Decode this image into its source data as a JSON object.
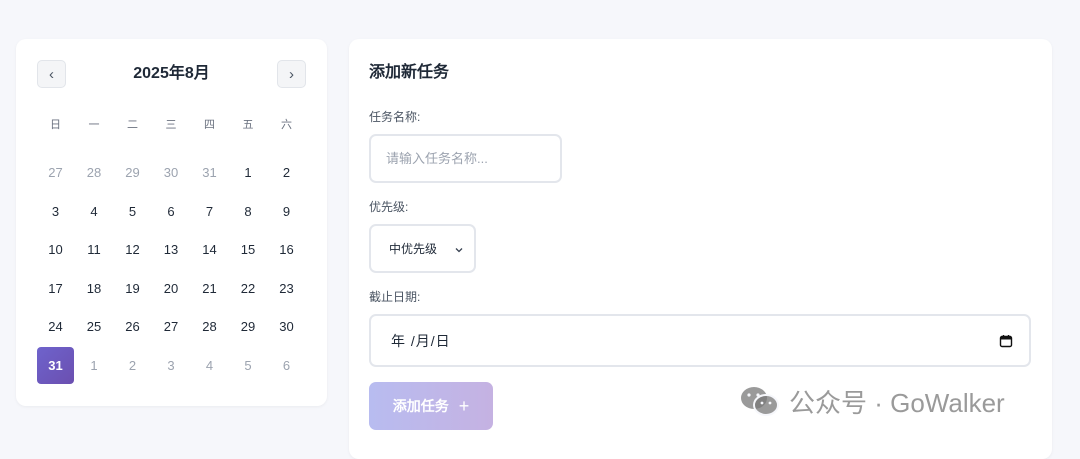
{
  "calendar": {
    "title": "2025年8月",
    "prev_label": "‹",
    "next_label": "›",
    "weekdays": [
      "日",
      "一",
      "二",
      "三",
      "四",
      "五",
      "六"
    ],
    "days": [
      {
        "label": "27",
        "other": true
      },
      {
        "label": "28",
        "other": true
      },
      {
        "label": "29",
        "other": true
      },
      {
        "label": "30",
        "other": true
      },
      {
        "label": "31",
        "other": true
      },
      {
        "label": "1"
      },
      {
        "label": "2"
      },
      {
        "label": "3"
      },
      {
        "label": "4"
      },
      {
        "label": "5"
      },
      {
        "label": "6"
      },
      {
        "label": "7"
      },
      {
        "label": "8"
      },
      {
        "label": "9"
      },
      {
        "label": "10"
      },
      {
        "label": "11"
      },
      {
        "label": "12"
      },
      {
        "label": "13"
      },
      {
        "label": "14"
      },
      {
        "label": "15"
      },
      {
        "label": "16"
      },
      {
        "label": "17"
      },
      {
        "label": "18"
      },
      {
        "label": "19"
      },
      {
        "label": "20"
      },
      {
        "label": "21"
      },
      {
        "label": "22"
      },
      {
        "label": "23"
      },
      {
        "label": "24"
      },
      {
        "label": "25"
      },
      {
        "label": "26"
      },
      {
        "label": "27"
      },
      {
        "label": "28"
      },
      {
        "label": "29"
      },
      {
        "label": "30"
      },
      {
        "label": "31",
        "selected": true
      },
      {
        "label": "1",
        "other": true
      },
      {
        "label": "2",
        "other": true
      },
      {
        "label": "3",
        "other": true
      },
      {
        "label": "4",
        "other": true
      },
      {
        "label": "5",
        "other": true
      },
      {
        "label": "6",
        "other": true
      }
    ],
    "selected_color": "#6b5bc4"
  },
  "form": {
    "title": "添加新任务",
    "name_label": "任务名称:",
    "name_value": "",
    "name_placeholder": "请输入任务名称...",
    "priority_label": "优先级:",
    "priority_value": "中优先级",
    "date_label": "截止日期:",
    "date_value": "年 /月/日",
    "date_icon": "calendar-icon",
    "add_label": "添加任务",
    "add_icon": "+"
  },
  "watermark": {
    "text": "公众号 · GoWalker",
    "icon": "wechat-icon"
  }
}
